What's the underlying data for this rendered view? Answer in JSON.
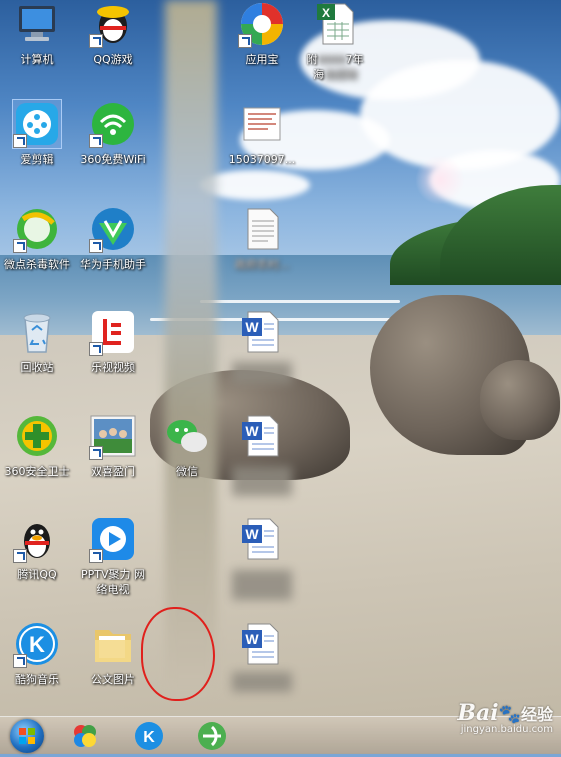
{
  "desktop": {
    "icons": [
      {
        "label": "计算机",
        "icon": "computer-icon"
      },
      {
        "label": "QQ游戏",
        "icon": "qq-game-icon"
      },
      {
        "label": "应用宝",
        "icon": "app-store-icon"
      },
      {
        "label": "附",
        "label2": "7年",
        "label3": "海",
        "icon": "excel-file-icon"
      },
      {
        "label": "爱剪辑",
        "icon": "video-editor-icon"
      },
      {
        "label": "360免费WiFi",
        "icon": "wifi-icon"
      },
      {
        "label": "15037097...",
        "icon": "document-thumbnail-icon"
      },
      {
        "label": "微点杀毒软件",
        "icon": "antivirus-icon"
      },
      {
        "label": "华为手机助手",
        "icon": "phone-assistant-icon"
      },
      {
        "label": "政府农村...",
        "icon": "text-file-icon"
      },
      {
        "label": "回收站",
        "icon": "recycle-bin-icon"
      },
      {
        "label": "乐视视频",
        "icon": "letv-icon"
      },
      {
        "label": "360安全卫士",
        "icon": "security-guard-icon"
      },
      {
        "label": "双喜盈门",
        "icon": "movie-thumbnail-icon"
      },
      {
        "label": "微信",
        "icon": "wechat-icon"
      },
      {
        "label": "腾讯QQ",
        "icon": "qq-penguin-icon"
      },
      {
        "label": "PPTV聚力 网络电视",
        "icon": "pptv-icon"
      },
      {
        "label": "酷狗音乐",
        "icon": "kugou-icon"
      },
      {
        "label": "公文图片",
        "icon": "folder-icon"
      }
    ]
  },
  "taskbar": {
    "start": "start-orb-icon",
    "pinned": [
      "colorful-app-icon",
      "kugou-icon",
      "browser-icon"
    ]
  },
  "watermark": {
    "logo": "Bai",
    "logo_cn": "经验",
    "url": "jingyan.baidu.com"
  }
}
